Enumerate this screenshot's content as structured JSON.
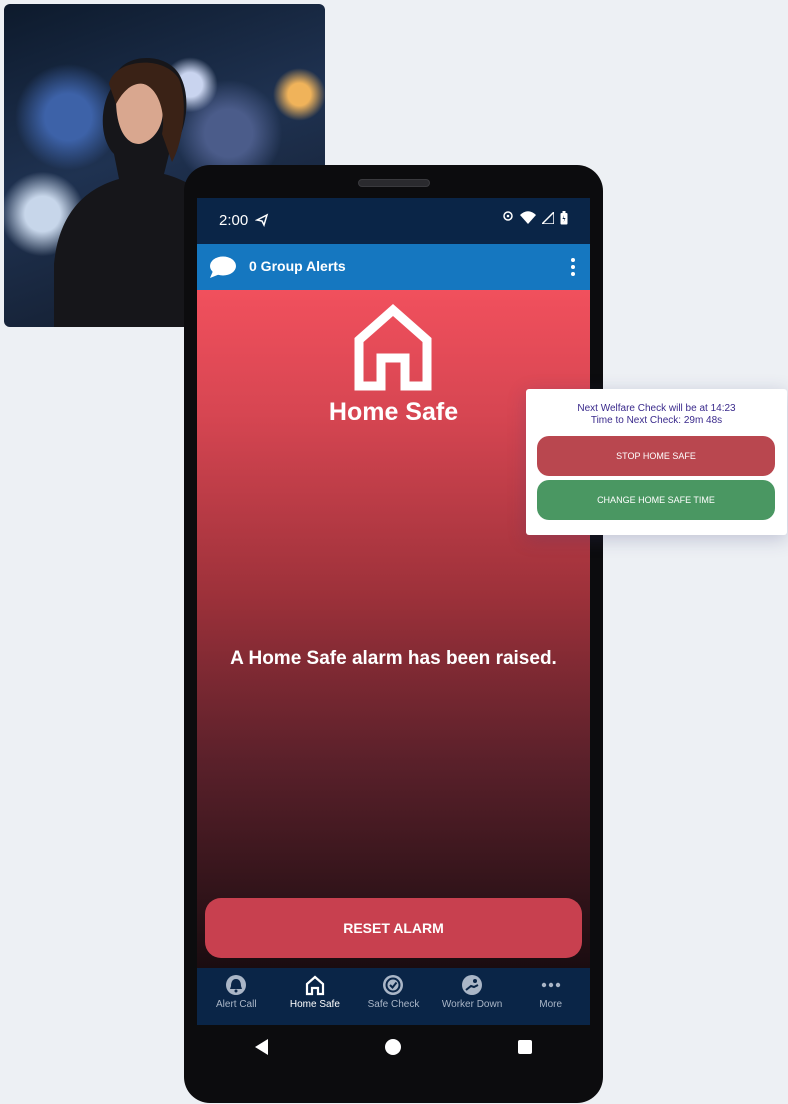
{
  "status_bar": {
    "time": "2:00"
  },
  "app_bar": {
    "title": "0 Group Alerts"
  },
  "main": {
    "page_title": "Home Safe",
    "alarm_message": "A Home Safe alarm has been raised.",
    "reset_label": "RESET ALARM"
  },
  "bottom_nav": {
    "items": [
      {
        "label": "Alert Call",
        "icon": "alert-call-icon"
      },
      {
        "label": "Home Safe",
        "icon": "home-icon",
        "active": true
      },
      {
        "label": "Safe Check",
        "icon": "safe-check-icon"
      },
      {
        "label": "Worker Down",
        "icon": "worker-down-icon"
      },
      {
        "label": "More",
        "icon": "more-dots-icon"
      }
    ]
  },
  "popup": {
    "line1": "Next Welfare Check will be at 14:23",
    "line2": "Time to Next Check: 29m 48s",
    "stop_label": "STOP HOME SAFE",
    "change_label": "CHANGE HOME SAFE TIME"
  },
  "colors": {
    "app_bar": "#1577c0",
    "status_bar": "#0a2547",
    "alarm_top": "#f1505d",
    "reset_button": "#c8404f",
    "stop_button": "#b9474f",
    "change_button": "#4a9762"
  }
}
